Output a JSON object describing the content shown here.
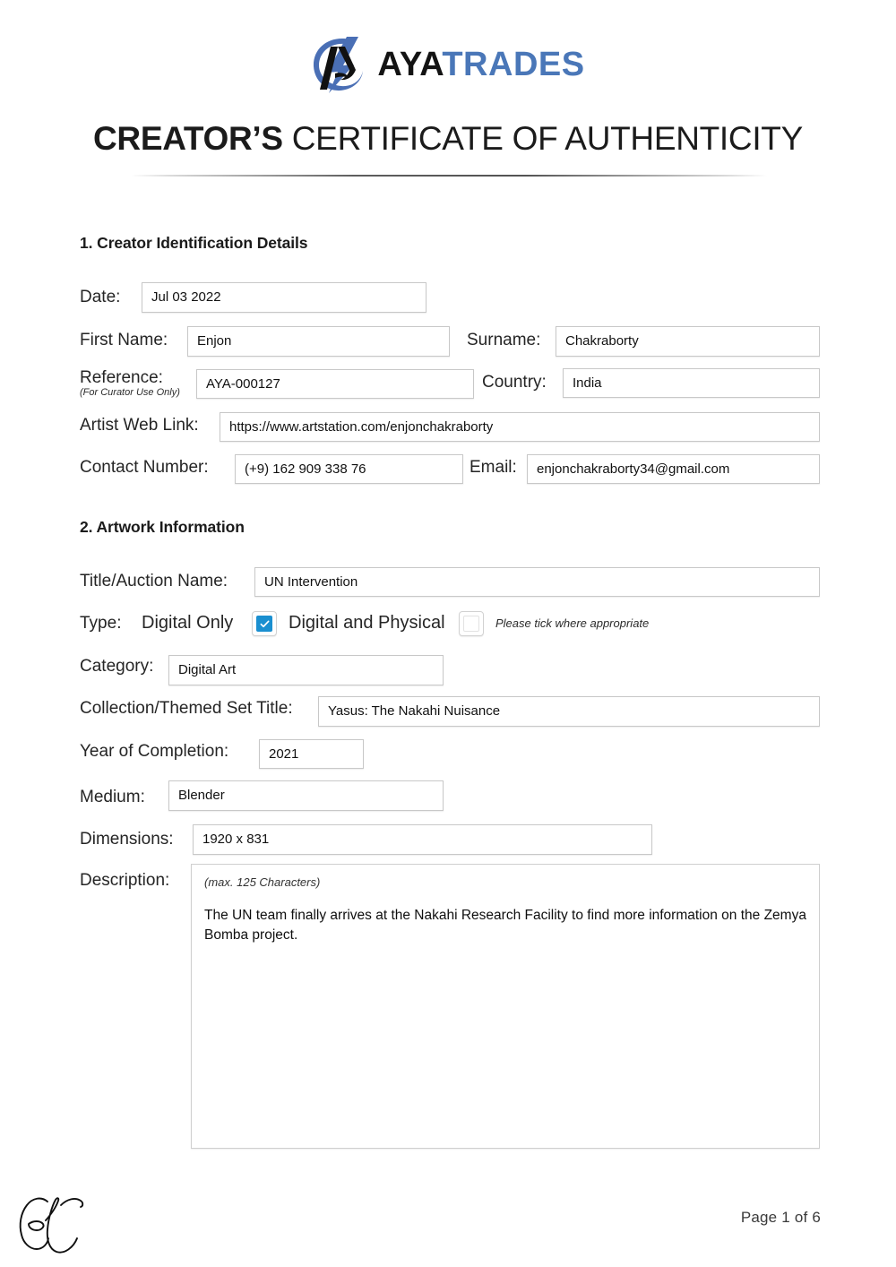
{
  "brand": {
    "logo_icon": "ayatrades-swoosh-logo",
    "name_dark": "AYA",
    "name_accent": "TRADES",
    "accent_color": "#4a77b8",
    "dark_color": "#131313"
  },
  "document": {
    "title_strong": "CREATOR’S",
    "title_light": "CERTIFICATE OF AUTHENTICITY"
  },
  "section1": {
    "heading": "1. Creator Identification Details",
    "fields": {
      "date_label": "Date:",
      "date_value": "Jul 03 2022",
      "first_name_label": "First Name:",
      "first_name_value": "Enjon",
      "surname_label": "Surname:",
      "surname_value": "Chakraborty",
      "reference_label": "Reference:",
      "reference_sublabel": "(For Curator Use Only)",
      "reference_value": "AYA-000127",
      "country_label": "Country:",
      "country_value": "India",
      "web_link_label": "Artist Web Link:",
      "web_link_value": "https://www.artstation.com/enjonchakraborty",
      "contact_label": "Contact Number:",
      "contact_value": "(+9) 162 909 338 76",
      "email_label": "Email:",
      "email_value": "enjonchakraborty34@gmail.com"
    }
  },
  "section2": {
    "heading": "2. Artwork Information",
    "fields": {
      "title_label": "Title/Auction Name:",
      "title_value": "UN Intervention",
      "type_label": "Type:",
      "type_option_1": "Digital Only",
      "type_option_2": "Digital and Physical",
      "type_hint": "Please tick where appropriate",
      "type_option_1_checked": true,
      "type_option_2_checked": false,
      "checkbox_accent": "#1a8fd0",
      "category_label": "Category:",
      "category_value": "Digital Art",
      "collection_label": "Collection/Themed Set Title:",
      "collection_value": "Yasus: The Nakahi Nuisance",
      "year_label": "Year of Completion:",
      "year_value": "2021",
      "medium_label": "Medium:",
      "medium_value": "Blender",
      "dimensions_label": "Dimensions:",
      "dimensions_value": "1920 x 831",
      "description_label": "Description:",
      "description_hint": "(max. 125 Characters)",
      "description_value": "The UN team finally arrives at the Nakahi Research Facility to find more information on the Zemya Bomba project."
    }
  },
  "footer": {
    "signature_icon": "handwritten-signature-ec",
    "page_number": "Page 1 of 6"
  }
}
